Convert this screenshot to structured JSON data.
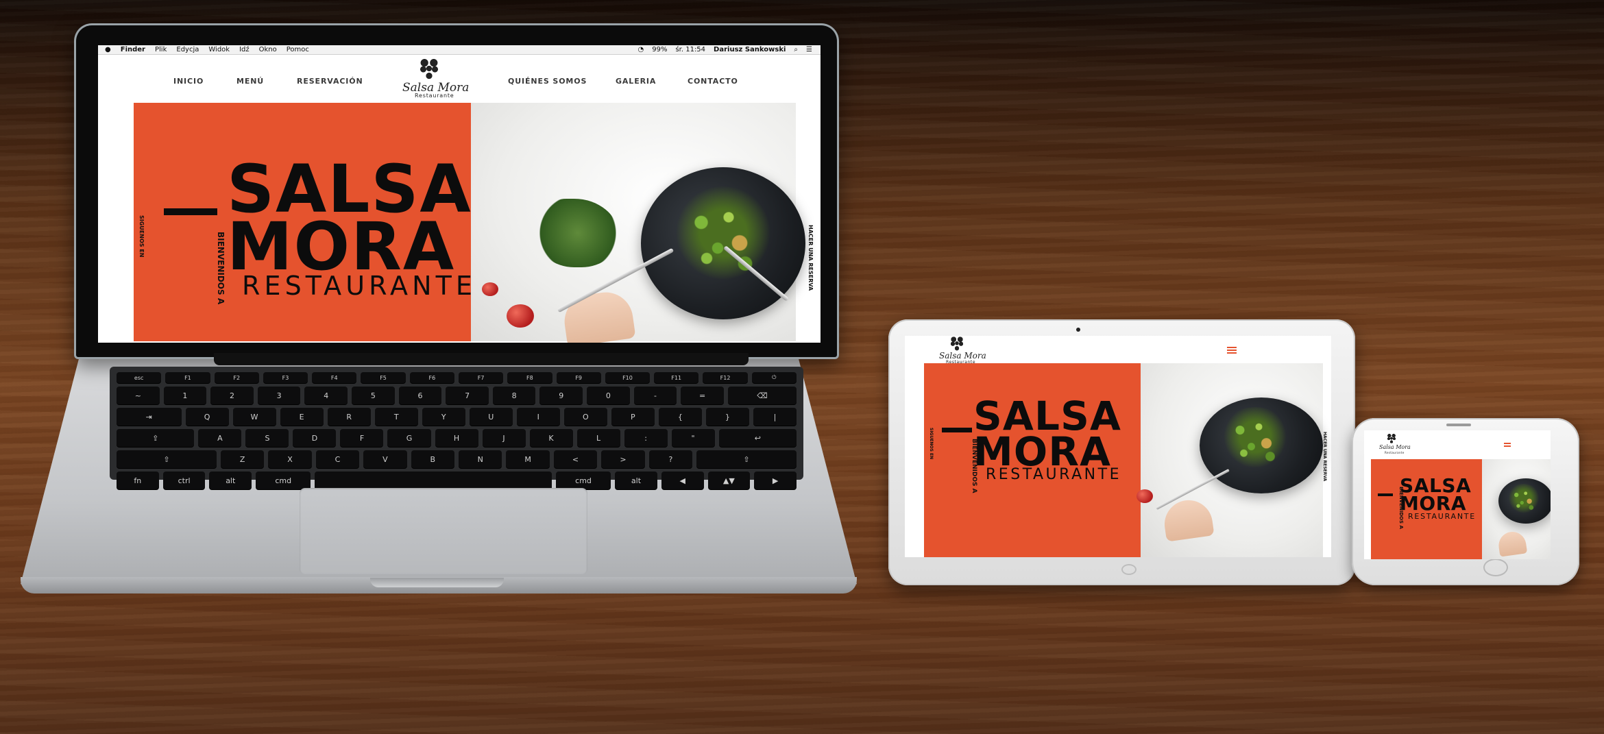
{
  "laptop": {
    "menubar": {
      "apple": "",
      "items": [
        "Finder",
        "Plik",
        "Edycja",
        "Widok",
        "Idź",
        "Okno",
        "Pomoc"
      ],
      "status": [
        "99%",
        "śr. 11:54",
        "Dariusz Sankowski"
      ]
    },
    "nav": {
      "left": [
        "INICIO",
        "MENÚ",
        "RESERVACIÓN"
      ],
      "right": [
        "QUIÉNES SOMOS",
        "GALERIA",
        "CONTACTO"
      ]
    },
    "logo": {
      "name": "Salsa Mora",
      "sub": "Restaurante"
    },
    "hero": {
      "line1": "SALSA",
      "line2": "MORA",
      "line3": "RESTAURANTE",
      "welcome": "BIENVENIDOS A",
      "side_left": "SIGUENOS EN",
      "side_right": "HACER UNA RESERVA"
    },
    "keyboard": {
      "fn_row": [
        "esc",
        "F1",
        "F2",
        "F3",
        "F4",
        "F5",
        "F6",
        "F7",
        "F8",
        "F9",
        "F10",
        "F11",
        "F12",
        "⏻"
      ],
      "row1": [
        "~",
        "1",
        "2",
        "3",
        "4",
        "5",
        "6",
        "7",
        "8",
        "9",
        "0",
        "-",
        "=",
        "⌫"
      ],
      "row2": [
        "⇥",
        "Q",
        "W",
        "E",
        "R",
        "T",
        "Y",
        "U",
        "I",
        "O",
        "P",
        "{",
        "}",
        "|"
      ],
      "row3": [
        "⇪",
        "A",
        "S",
        "D",
        "F",
        "G",
        "H",
        "J",
        "K",
        "L",
        ":",
        "\"",
        "↩"
      ],
      "row4": [
        "⇧",
        "Z",
        "X",
        "C",
        "V",
        "B",
        "N",
        "M",
        "<",
        ">",
        "?",
        "⇧"
      ],
      "row5": [
        "fn",
        "ctrl",
        "alt",
        "cmd",
        "",
        "cmd",
        "alt",
        "◀",
        "▲▼",
        "▶"
      ]
    }
  },
  "tablet": {
    "logo": {
      "name": "Salsa Mora",
      "sub": "Restaurante"
    },
    "hero": {
      "line1": "SALSA",
      "line2": "MORA",
      "line3": "RESTAURANTE",
      "welcome": "BIENVENIDOS A",
      "side_left": "SIGUENOS EN",
      "side_right": "HACER UNA RESERVA"
    }
  },
  "phone": {
    "logo": {
      "name": "Salsa Mora",
      "sub": "Restaurante"
    },
    "hero": {
      "line1": "SALSA",
      "line2": "MORA",
      "line3": "RESTAURANTE",
      "welcome": "BIENVENIDOS A"
    }
  },
  "colors": {
    "accent": "#e5532e",
    "text": "#0c0c0c",
    "wood": "#6b3a1c"
  }
}
